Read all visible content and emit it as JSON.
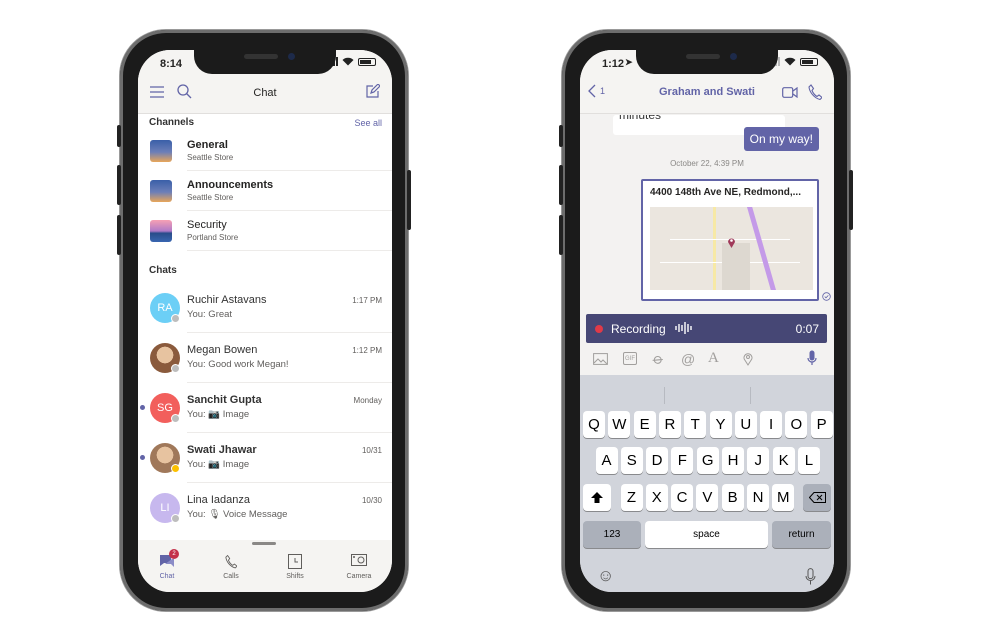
{
  "left_phone": {
    "status_time": "8:14",
    "header": {
      "title": "Chat",
      "menu_icon": "hamburger-icon",
      "search_icon": "search-icon",
      "compose_icon": "compose-icon"
    },
    "channels_label": "Channels",
    "see_all": "See all",
    "channels": [
      {
        "name": "General",
        "sub": "Seattle Store",
        "bold": true,
        "thumb": "space-needle"
      },
      {
        "name": "Announcements",
        "sub": "Seattle Store",
        "bold": true,
        "thumb": "space-needle"
      },
      {
        "name": "Security",
        "sub": "Portland Store",
        "bold": false,
        "thumb": "portland-sunset"
      }
    ],
    "chats_label": "Chats",
    "chats": [
      {
        "name": "Ruchir Astavans",
        "preview": "You: Great",
        "time": "1:17 PM",
        "initials": "RA",
        "color": "#6ccff6",
        "unread": false,
        "presence": "#bdbdbd"
      },
      {
        "name": "Megan Bowen",
        "preview": "You: Good work Megan!",
        "time": "1:12 PM",
        "initials": "",
        "photo": true,
        "color": "#8a5a3c",
        "unread": false,
        "presence": "#bdbdbd"
      },
      {
        "name": "Sanchit Gupta",
        "preview": "You: 📷 Image",
        "time": "Monday",
        "initials": "SG",
        "color": "#f25f5c",
        "unread": true,
        "presence": "#bdbdbd"
      },
      {
        "name": "Swati Jhawar",
        "preview": "You: 📷 Image",
        "time": "10/31",
        "initials": "",
        "photo": true,
        "color": "#a0785a",
        "unread": true,
        "presence": "#fcc000"
      },
      {
        "name": "Lina Iadanza",
        "preview": "You: 🎙 Voice Message",
        "time": "10/30",
        "initials": "LI",
        "color": "#c7b8ee",
        "unread": false,
        "presence": "#bdbdbd"
      }
    ],
    "tabs": [
      {
        "label": "Chat",
        "icon": "chat-icon",
        "active": true,
        "badge": "2"
      },
      {
        "label": "Calls",
        "icon": "phone-icon",
        "active": false
      },
      {
        "label": "Shifts",
        "icon": "clock-icon",
        "active": false
      },
      {
        "label": "Camera",
        "icon": "camera-icon",
        "active": false
      }
    ]
  },
  "right_phone": {
    "status_time": "1:12",
    "header": {
      "back_count": "1",
      "title": "Graham and Swati",
      "video_icon": "video-icon",
      "call_icon": "phone-icon"
    },
    "partial_message": "minutes",
    "sent_message": "On my way!",
    "timestamp": "October 22, 4:39 PM",
    "location_card": {
      "address": "4400 148th Ave NE,  Redmond,..."
    },
    "recording": {
      "label": "Recording",
      "duration": "0:07"
    },
    "compose_icons": [
      "image-icon",
      "gif-icon",
      "attach-icon",
      "mention-icon",
      "format-icon",
      "location-icon",
      "mic-icon"
    ],
    "gif_label": "GIF",
    "keyboard": {
      "row1": [
        "Q",
        "W",
        "E",
        "R",
        "T",
        "Y",
        "U",
        "I",
        "O",
        "P"
      ],
      "row2": [
        "A",
        "S",
        "D",
        "F",
        "G",
        "H",
        "J",
        "K",
        "L"
      ],
      "row3": [
        "Z",
        "X",
        "C",
        "V",
        "B",
        "N",
        "M"
      ],
      "numbers": "123",
      "space": "space",
      "return": "return"
    }
  },
  "colors": {
    "accent": "#6264a7",
    "recording_bar": "#464775",
    "record_dot": "#e03a48",
    "keyboard_bg": "#d1d4db"
  }
}
